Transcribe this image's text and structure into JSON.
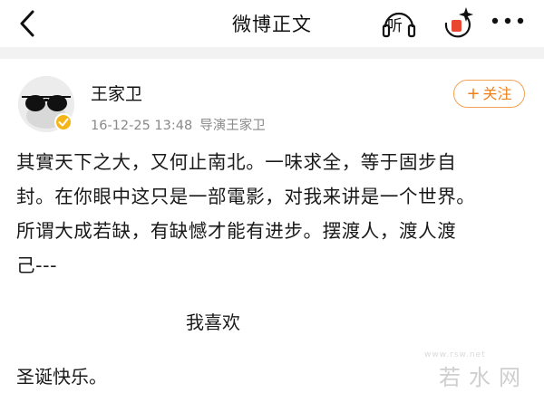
{
  "header": {
    "title": "微博正文",
    "listen_label": "听"
  },
  "post": {
    "author": "王家卫",
    "timestamp": "16-12-25 13:48",
    "source": "导演王家卫",
    "follow_label": "关注",
    "follow_plus": "+",
    "lines": [
      "其實天下之大，又何止南北。一味求全，等于固步自",
      "封。在你眼中这只是一部電影，对我来讲是一个世界。",
      "所谓大成若缺，有缺憾才能有进步。摆渡人，渡人渡",
      "己---"
    ],
    "center_text": "我喜欢",
    "closing_text": "圣诞快乐。"
  },
  "watermark": {
    "text": "若水网",
    "domain": "www.rsw.net"
  },
  "colors": {
    "accent": "#f07f1a",
    "follow_border": "#f1a257",
    "meta": "#8a8a8a",
    "divider": "#f2f2f2",
    "verified_badge": "#f5b418"
  },
  "icons": {
    "back": "chevron-left-icon",
    "listen": "headphones-icon",
    "share": "share-sparkle-icon",
    "more": "more-dots-icon",
    "verified": "verified-badge-icon"
  }
}
